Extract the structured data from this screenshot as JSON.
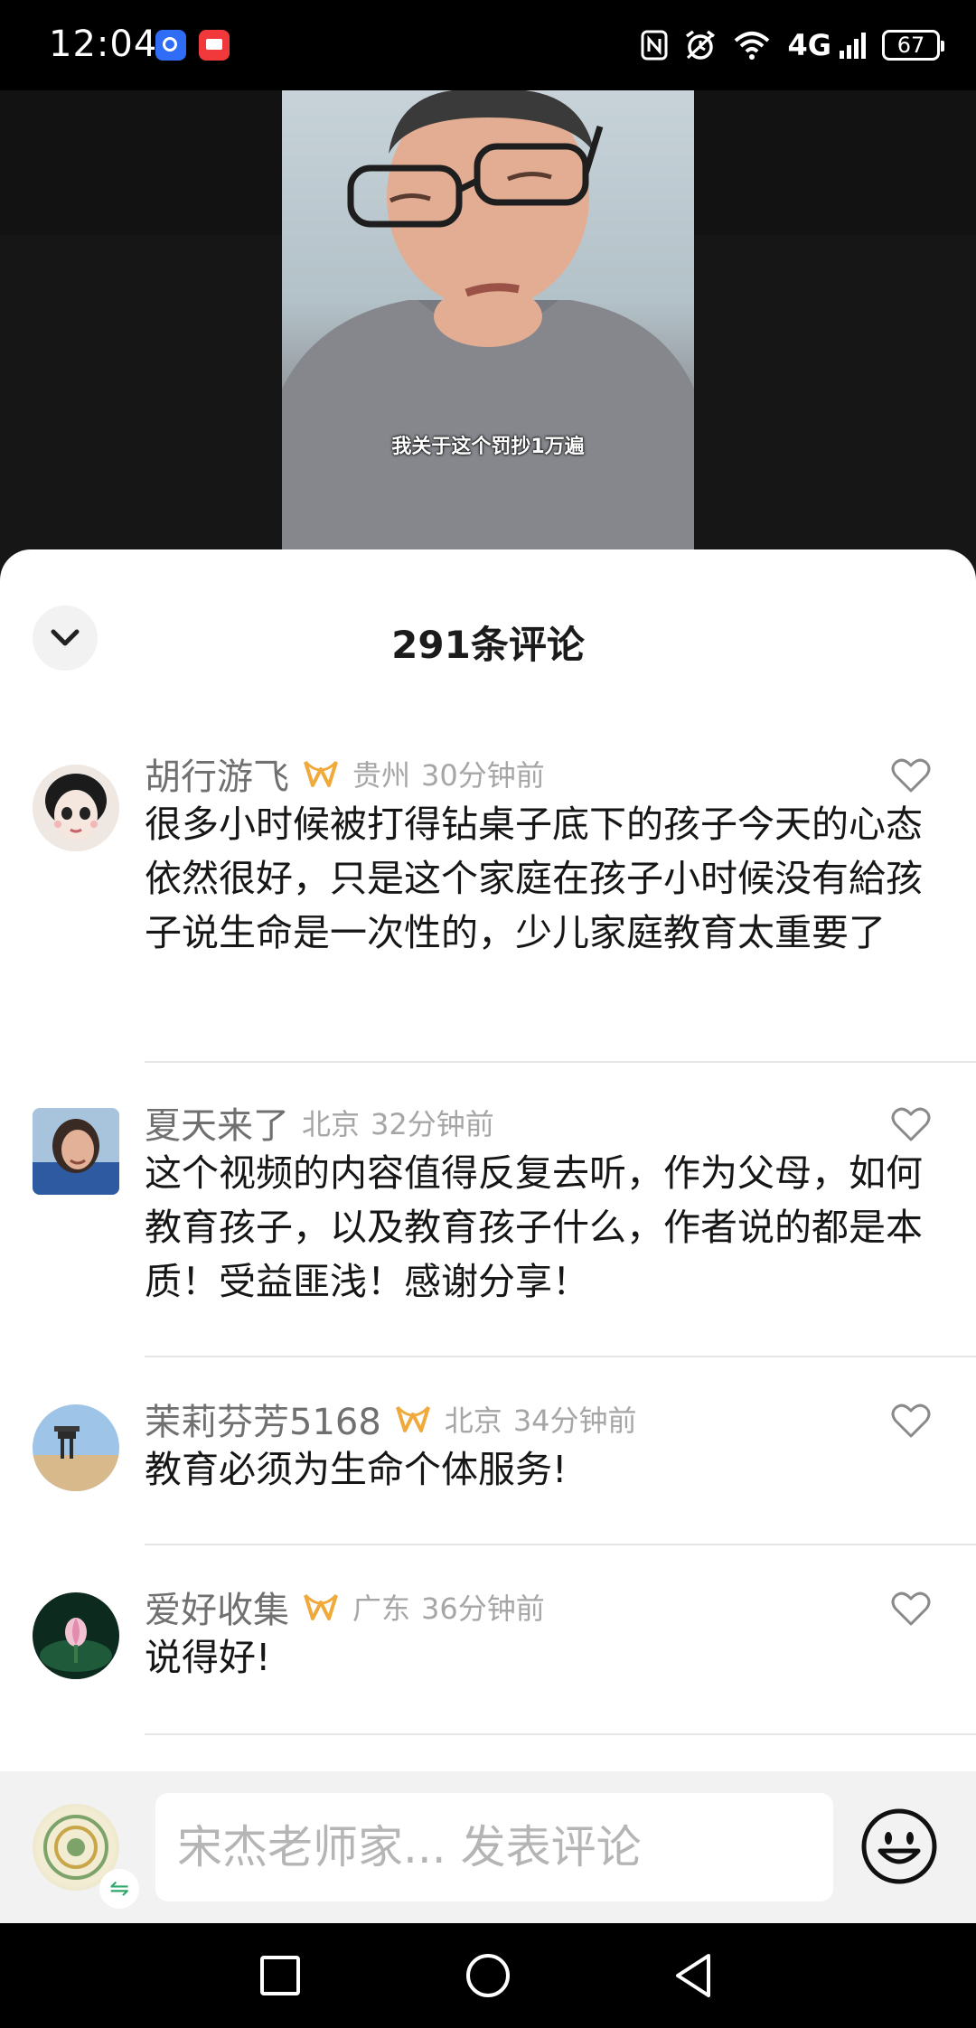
{
  "status_bar": {
    "time": "12:04",
    "network": "4G",
    "battery": "67",
    "icons": [
      "app-icon-blue",
      "app-icon-red",
      "nfc-icon",
      "alarm-icon",
      "wifi-icon",
      "signal-icon",
      "battery-icon"
    ]
  },
  "video": {
    "subtitle": "我关于这个罚抄1万遍"
  },
  "sheet": {
    "title": "291条评论"
  },
  "comments": [
    {
      "user": "胡行游飞",
      "vip": true,
      "location": "贵州",
      "time": "30分钟前",
      "text": "很多小时候被打得钻桌子底下的孩子今天的心态依然很好，只是这个家庭在孩子小时候没有給孩子说生命是一次性的，少儿家庭教育太重要了"
    },
    {
      "user": "夏天来了",
      "vip": false,
      "location": "北京",
      "time": "32分钟前",
      "text": "这个视频的内容值得反复去听，作为父母，如何教育孩子，以及教育孩子什么，作者说的都是本质！受益匪浅！感谢分享！"
    },
    {
      "user": "茉莉芬芳5168",
      "vip": true,
      "location": "北京",
      "time": "34分钟前",
      "text": "教育必须为生命个体服务!"
    },
    {
      "user": "爱好收集",
      "vip": true,
      "location": "广东",
      "time": "36分钟前",
      "text": "说得好!"
    }
  ],
  "comment_bar": {
    "placeholder": "宋杰老师家... 发表评论"
  },
  "colors": {
    "vip_gold": "#f0a93b",
    "text_primary": "#161616",
    "text_secondary": "#707070",
    "meta": "#a6a6a6"
  }
}
